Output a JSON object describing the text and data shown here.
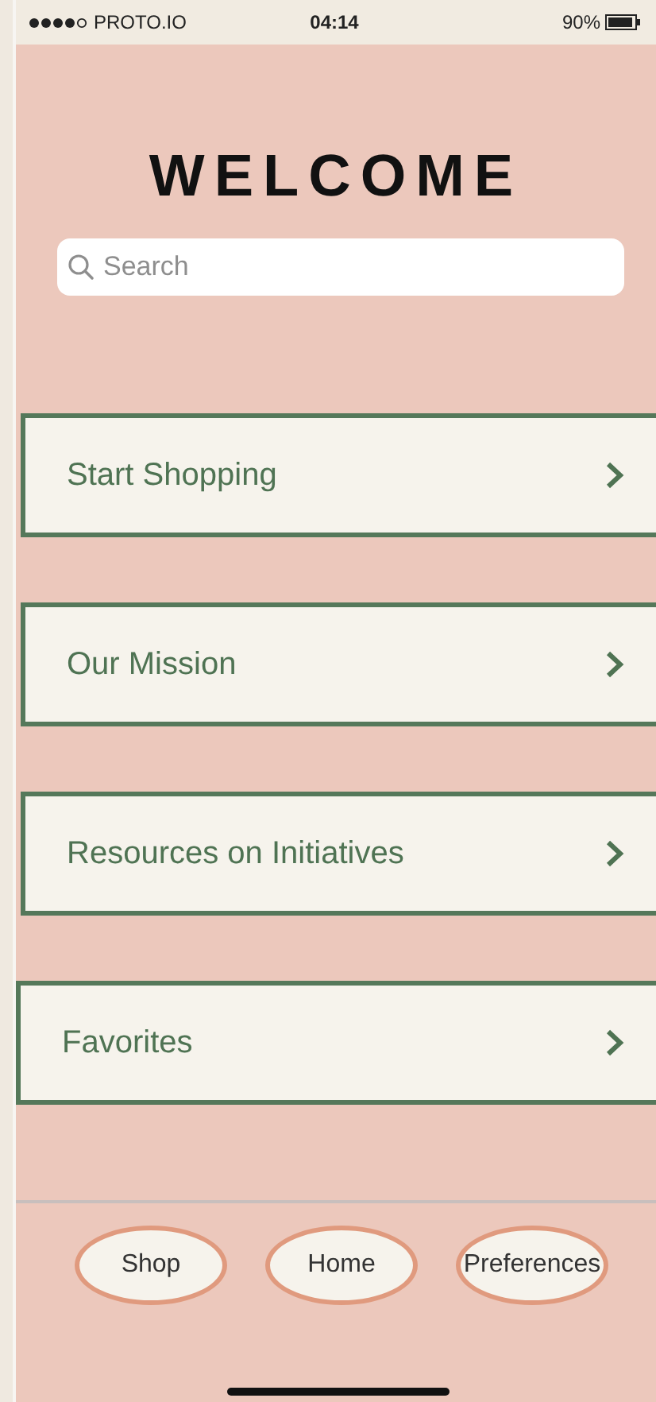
{
  "status_bar": {
    "carrier": "PROTO.IO",
    "time": "04:14",
    "battery": "90%"
  },
  "title": "WELCOME",
  "search": {
    "placeholder": "Search"
  },
  "menu_items": [
    {
      "label": "Start Shopping"
    },
    {
      "label": "Our Mission"
    },
    {
      "label": "Resources on Initiatives"
    },
    {
      "label": "Favorites"
    }
  ],
  "bottom_buttons": [
    {
      "label": "Shop"
    },
    {
      "label": "Home"
    },
    {
      "label": "Preferences"
    }
  ]
}
